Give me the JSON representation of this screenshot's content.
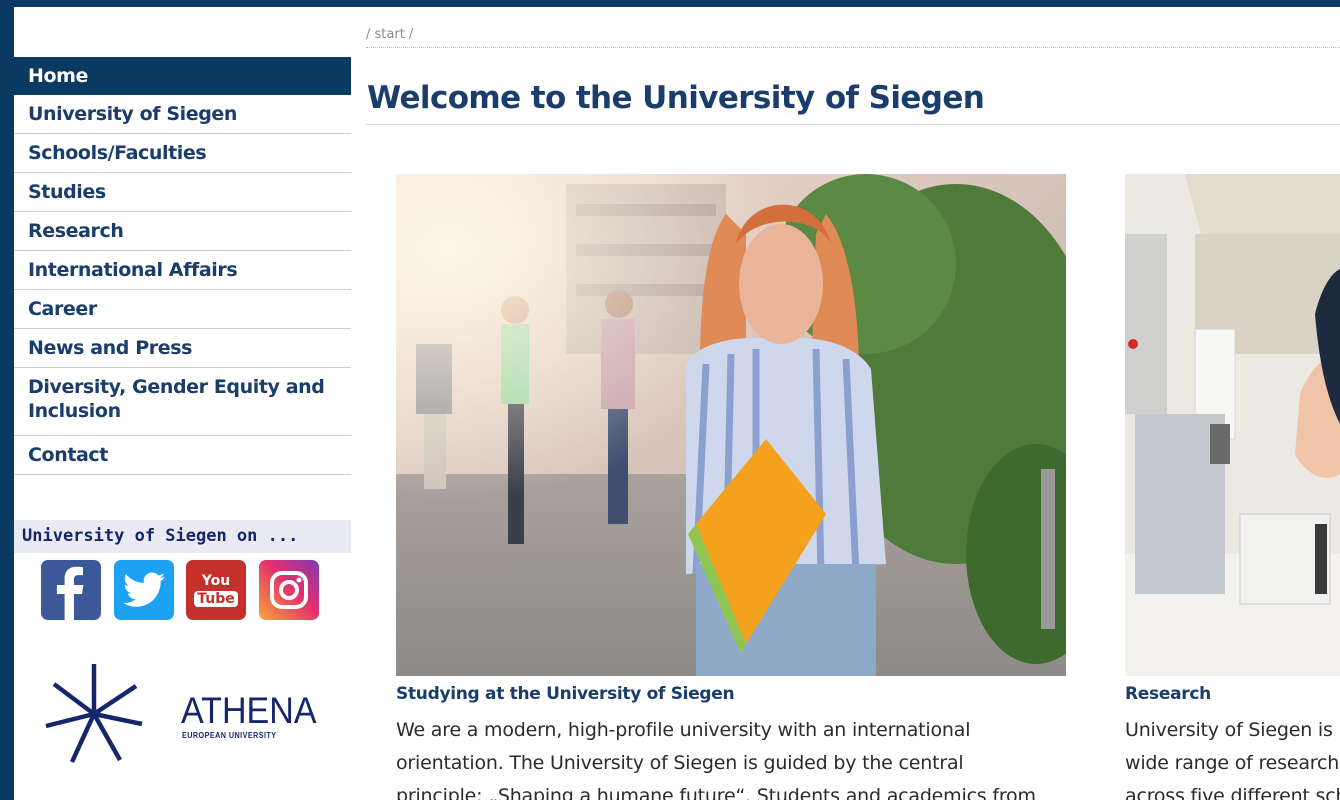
{
  "sidebar": {
    "nav": [
      {
        "label": "Home",
        "active": true
      },
      {
        "label": "University of Siegen"
      },
      {
        "label": "Schools/Faculties"
      },
      {
        "label": "Studies"
      },
      {
        "label": "Research"
      },
      {
        "label": "International Affairs"
      },
      {
        "label": "Career"
      },
      {
        "label": "News and Press"
      },
      {
        "label": "Diversity, Gender Equity and Inclusion"
      },
      {
        "label": "Contact"
      }
    ],
    "social": {
      "heading": "University of Siegen on ...",
      "icons": [
        "facebook-icon",
        "twitter-icon",
        "youtube-icon",
        "instagram-icon"
      ],
      "youtube_top": "You",
      "youtube_bottom": "Tube"
    },
    "athena": {
      "name": "ATHENA",
      "subtitle": "EUROPEAN UNIVERSITY"
    }
  },
  "main": {
    "breadcrumb": "/ start /",
    "title": "Welcome to the University of Siegen",
    "cards": [
      {
        "title": "Studying at the University of Siegen",
        "text_lines": [
          "We are a modern, high-profile university with an international",
          "orientation. The University of Siegen is guided by the central",
          "principle: „Shaping a humane future“. Students and academics from"
        ]
      },
      {
        "title": "Research",
        "text_lines": [
          "University of Siegen is",
          "wide range of research",
          "across five different sch"
        ]
      }
    ]
  },
  "colors": {
    "brand": "#0a3a62",
    "nav_text": "#1a3d6b",
    "social_heading_bg": "#e8ebf2"
  }
}
